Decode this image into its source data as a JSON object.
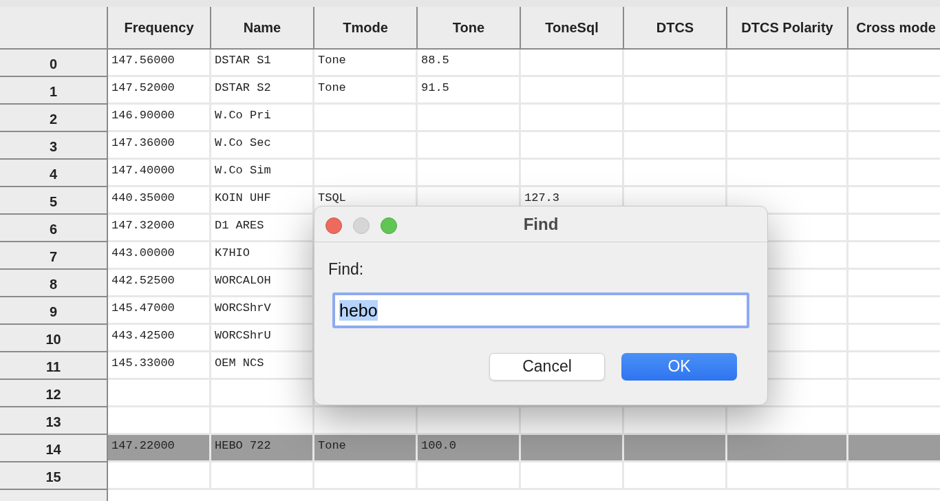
{
  "table": {
    "columns": [
      "Frequency",
      "Name",
      "Tmode",
      "Tone",
      "ToneSql",
      "DTCS",
      "DTCS Polarity",
      "Cross mode"
    ],
    "rows": [
      {
        "label": "0",
        "selected": false,
        "cells": [
          "147.56000",
          "DSTAR S1",
          "Tone",
          "88.5"
        ]
      },
      {
        "label": "1",
        "selected": false,
        "cells": [
          "147.52000",
          "DSTAR S2",
          "Tone",
          "91.5"
        ]
      },
      {
        "label": "2",
        "selected": false,
        "cells": [
          "146.90000",
          "W.Co Pri"
        ]
      },
      {
        "label": "3",
        "selected": false,
        "cells": [
          "147.36000",
          "W.Co Sec"
        ]
      },
      {
        "label": "4",
        "selected": false,
        "cells": [
          "147.40000",
          "W.Co Sim"
        ]
      },
      {
        "label": "5",
        "selected": false,
        "cells": [
          "440.35000",
          "KOIN UHF",
          "TSQL",
          null,
          "127.3"
        ]
      },
      {
        "label": "6",
        "selected": false,
        "cells": [
          "147.32000",
          "D1 ARES"
        ]
      },
      {
        "label": "7",
        "selected": false,
        "cells": [
          "443.00000",
          "K7HIO"
        ]
      },
      {
        "label": "8",
        "selected": false,
        "cells": [
          "442.52500",
          "WORCALOH"
        ]
      },
      {
        "label": "9",
        "selected": false,
        "cells": [
          "145.47000",
          "WORCShrV"
        ]
      },
      {
        "label": "10",
        "selected": false,
        "cells": [
          "443.42500",
          "WORCShrU"
        ]
      },
      {
        "label": "11",
        "selected": false,
        "cells": [
          "145.33000",
          "OEM NCS"
        ]
      },
      {
        "label": "12",
        "selected": false,
        "cells": []
      },
      {
        "label": "13",
        "selected": false,
        "cells": []
      },
      {
        "label": "14",
        "selected": true,
        "cells": [
          "147.22000",
          "HEBO 722",
          "Tone",
          "100.0"
        ]
      },
      {
        "label": "15",
        "selected": false,
        "cells": []
      }
    ]
  },
  "dialog": {
    "title": "Find",
    "label": "Find:",
    "value": "hebo",
    "value_selected": true,
    "buttons": [
      {
        "label": "Cancel",
        "default": false
      },
      {
        "label": "OK",
        "default": true
      }
    ]
  }
}
